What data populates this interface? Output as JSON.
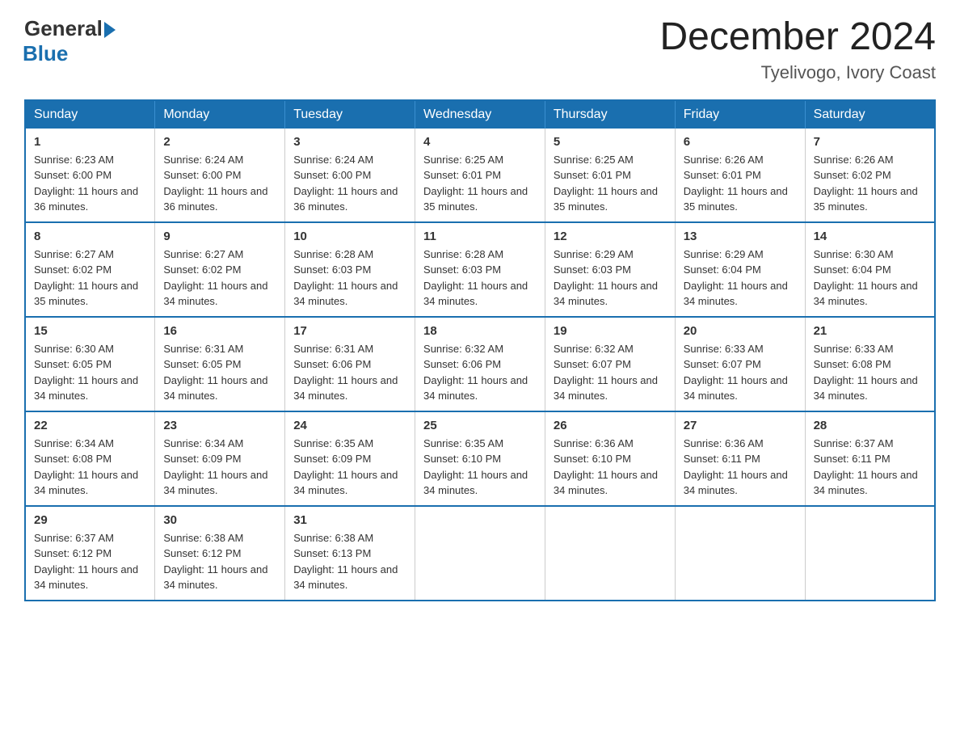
{
  "header": {
    "logo_general": "General",
    "logo_blue": "Blue",
    "month_title": "December 2024",
    "location": "Tyelivogo, Ivory Coast"
  },
  "calendar": {
    "days_of_week": [
      "Sunday",
      "Monday",
      "Tuesday",
      "Wednesday",
      "Thursday",
      "Friday",
      "Saturday"
    ],
    "weeks": [
      [
        {
          "day": "1",
          "sunrise": "6:23 AM",
          "sunset": "6:00 PM",
          "daylight": "11 hours and 36 minutes."
        },
        {
          "day": "2",
          "sunrise": "6:24 AM",
          "sunset": "6:00 PM",
          "daylight": "11 hours and 36 minutes."
        },
        {
          "day": "3",
          "sunrise": "6:24 AM",
          "sunset": "6:00 PM",
          "daylight": "11 hours and 36 minutes."
        },
        {
          "day": "4",
          "sunrise": "6:25 AM",
          "sunset": "6:01 PM",
          "daylight": "11 hours and 35 minutes."
        },
        {
          "day": "5",
          "sunrise": "6:25 AM",
          "sunset": "6:01 PM",
          "daylight": "11 hours and 35 minutes."
        },
        {
          "day": "6",
          "sunrise": "6:26 AM",
          "sunset": "6:01 PM",
          "daylight": "11 hours and 35 minutes."
        },
        {
          "day": "7",
          "sunrise": "6:26 AM",
          "sunset": "6:02 PM",
          "daylight": "11 hours and 35 minutes."
        }
      ],
      [
        {
          "day": "8",
          "sunrise": "6:27 AM",
          "sunset": "6:02 PM",
          "daylight": "11 hours and 35 minutes."
        },
        {
          "day": "9",
          "sunrise": "6:27 AM",
          "sunset": "6:02 PM",
          "daylight": "11 hours and 34 minutes."
        },
        {
          "day": "10",
          "sunrise": "6:28 AM",
          "sunset": "6:03 PM",
          "daylight": "11 hours and 34 minutes."
        },
        {
          "day": "11",
          "sunrise": "6:28 AM",
          "sunset": "6:03 PM",
          "daylight": "11 hours and 34 minutes."
        },
        {
          "day": "12",
          "sunrise": "6:29 AM",
          "sunset": "6:03 PM",
          "daylight": "11 hours and 34 minutes."
        },
        {
          "day": "13",
          "sunrise": "6:29 AM",
          "sunset": "6:04 PM",
          "daylight": "11 hours and 34 minutes."
        },
        {
          "day": "14",
          "sunrise": "6:30 AM",
          "sunset": "6:04 PM",
          "daylight": "11 hours and 34 minutes."
        }
      ],
      [
        {
          "day": "15",
          "sunrise": "6:30 AM",
          "sunset": "6:05 PM",
          "daylight": "11 hours and 34 minutes."
        },
        {
          "day": "16",
          "sunrise": "6:31 AM",
          "sunset": "6:05 PM",
          "daylight": "11 hours and 34 minutes."
        },
        {
          "day": "17",
          "sunrise": "6:31 AM",
          "sunset": "6:06 PM",
          "daylight": "11 hours and 34 minutes."
        },
        {
          "day": "18",
          "sunrise": "6:32 AM",
          "sunset": "6:06 PM",
          "daylight": "11 hours and 34 minutes."
        },
        {
          "day": "19",
          "sunrise": "6:32 AM",
          "sunset": "6:07 PM",
          "daylight": "11 hours and 34 minutes."
        },
        {
          "day": "20",
          "sunrise": "6:33 AM",
          "sunset": "6:07 PM",
          "daylight": "11 hours and 34 minutes."
        },
        {
          "day": "21",
          "sunrise": "6:33 AM",
          "sunset": "6:08 PM",
          "daylight": "11 hours and 34 minutes."
        }
      ],
      [
        {
          "day": "22",
          "sunrise": "6:34 AM",
          "sunset": "6:08 PM",
          "daylight": "11 hours and 34 minutes."
        },
        {
          "day": "23",
          "sunrise": "6:34 AM",
          "sunset": "6:09 PM",
          "daylight": "11 hours and 34 minutes."
        },
        {
          "day": "24",
          "sunrise": "6:35 AM",
          "sunset": "6:09 PM",
          "daylight": "11 hours and 34 minutes."
        },
        {
          "day": "25",
          "sunrise": "6:35 AM",
          "sunset": "6:10 PM",
          "daylight": "11 hours and 34 minutes."
        },
        {
          "day": "26",
          "sunrise": "6:36 AM",
          "sunset": "6:10 PM",
          "daylight": "11 hours and 34 minutes."
        },
        {
          "day": "27",
          "sunrise": "6:36 AM",
          "sunset": "6:11 PM",
          "daylight": "11 hours and 34 minutes."
        },
        {
          "day": "28",
          "sunrise": "6:37 AM",
          "sunset": "6:11 PM",
          "daylight": "11 hours and 34 minutes."
        }
      ],
      [
        {
          "day": "29",
          "sunrise": "6:37 AM",
          "sunset": "6:12 PM",
          "daylight": "11 hours and 34 minutes."
        },
        {
          "day": "30",
          "sunrise": "6:38 AM",
          "sunset": "6:12 PM",
          "daylight": "11 hours and 34 minutes."
        },
        {
          "day": "31",
          "sunrise": "6:38 AM",
          "sunset": "6:13 PM",
          "daylight": "11 hours and 34 minutes."
        },
        null,
        null,
        null,
        null
      ]
    ]
  }
}
